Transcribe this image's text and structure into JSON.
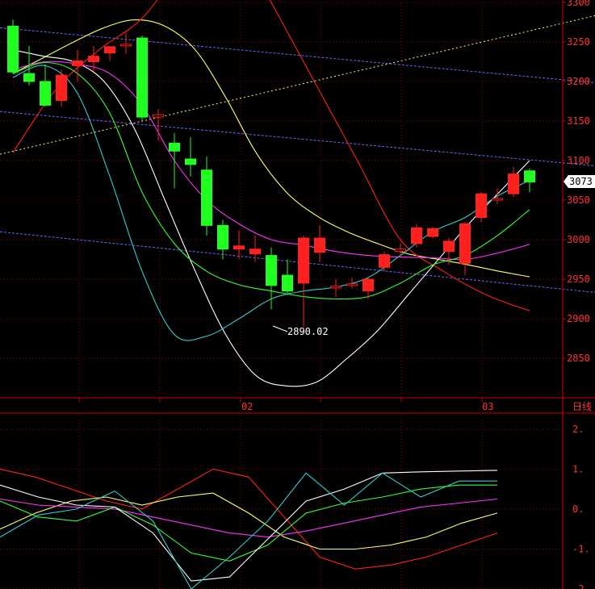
{
  "chart_data": {
    "type": "candlestick",
    "price_panel": {
      "ylim": [
        2800,
        3300
      ],
      "y_ticks": [
        "3300",
        "3250",
        "3200",
        "3150",
        "3100",
        "3050",
        "3000",
        "2950",
        "2900",
        "2850"
      ],
      "x_ticks": [
        "02",
        "03"
      ],
      "period_label": "日线",
      "current_price": "3073",
      "low_annotation": "2890.02",
      "colors": {
        "up": "#ff2020",
        "down": "#20ff20",
        "grid": "#8b0000"
      },
      "candles": [
        {
          "o": 3270,
          "h": 3278,
          "l": 3210,
          "c": 3212
        },
        {
          "o": 3210,
          "h": 3245,
          "l": 3195,
          "c": 3200
        },
        {
          "o": 3200,
          "h": 3222,
          "l": 3168,
          "c": 3170
        },
        {
          "o": 3176,
          "h": 3215,
          "l": 3168,
          "c": 3208
        },
        {
          "o": 3220,
          "h": 3240,
          "l": 3200,
          "c": 3226
        },
        {
          "o": 3225,
          "h": 3245,
          "l": 3212,
          "c": 3232
        },
        {
          "o": 3236,
          "h": 3245,
          "l": 3226,
          "c": 3244
        },
        {
          "o": 3245,
          "h": 3262,
          "l": 3235,
          "c": 3247
        },
        {
          "o": 3255,
          "h": 3258,
          "l": 3150,
          "c": 3155
        },
        {
          "o": 3155,
          "h": 3165,
          "l": 3125,
          "c": 3158
        },
        {
          "o": 3122,
          "h": 3135,
          "l": 3065,
          "c": 3112
        },
        {
          "o": 3102,
          "h": 3130,
          "l": 3080,
          "c": 3095
        },
        {
          "o": 3088,
          "h": 3105,
          "l": 3005,
          "c": 3018
        },
        {
          "o": 3018,
          "h": 3025,
          "l": 2975,
          "c": 2988
        },
        {
          "o": 2988,
          "h": 3012,
          "l": 2975,
          "c": 2992
        },
        {
          "o": 2982,
          "h": 3005,
          "l": 2972,
          "c": 2988
        },
        {
          "o": 2980,
          "h": 2990,
          "l": 2912,
          "c": 2942
        },
        {
          "o": 2955,
          "h": 2975,
          "l": 2930,
          "c": 2935
        },
        {
          "o": 2945,
          "h": 3005,
          "l": 2890,
          "c": 3002
        },
        {
          "o": 2984,
          "h": 3018,
          "l": 2972,
          "c": 3002
        },
        {
          "o": 2939,
          "h": 2950,
          "l": 2928,
          "c": 2941
        },
        {
          "o": 2942,
          "h": 2952,
          "l": 2938,
          "c": 2944
        },
        {
          "o": 2935,
          "h": 2952,
          "l": 2925,
          "c": 2950
        },
        {
          "o": 2965,
          "h": 2985,
          "l": 2960,
          "c": 2981
        },
        {
          "o": 2985,
          "h": 2995,
          "l": 2978,
          "c": 2988
        },
        {
          "o": 2995,
          "h": 3020,
          "l": 2990,
          "c": 3015
        },
        {
          "o": 3004,
          "h": 3016,
          "l": 3002,
          "c": 3014
        },
        {
          "o": 2985,
          "h": 3002,
          "l": 2968,
          "c": 2998
        },
        {
          "o": 2970,
          "h": 3022,
          "l": 2955,
          "c": 3020
        },
        {
          "o": 3028,
          "h": 3060,
          "l": 3022,
          "c": 3058
        },
        {
          "o": 3050,
          "h": 3065,
          "l": 3045,
          "c": 3052
        },
        {
          "o": 3058,
          "h": 3092,
          "l": 3054,
          "c": 3083
        },
        {
          "o": 3087,
          "h": 3090,
          "l": 3060,
          "c": 3073
        }
      ],
      "ma_lines": [
        {
          "color": "#ffff66",
          "values": [
            3210,
            3230,
            3250,
            3268,
            3278,
            3270,
            3240,
            3180,
            3110,
            3060,
            3030,
            3010,
            2995,
            2982,
            2975,
            2968,
            2960,
            2953
          ]
        },
        {
          "color": "#ff2020",
          "values": [
            3110,
            3190,
            3240,
            3280,
            3350,
            3400,
            3300,
            3200,
            3100,
            3000,
            2960,
            2930,
            2910
          ]
        },
        {
          "color": "#ffffff",
          "values": [
            3240,
            3232,
            3225,
            3200,
            3140,
            3050,
            2960,
            2880,
            2828,
            2815,
            2820,
            2850,
            2885,
            2930,
            2975,
            3020,
            3060,
            3100
          ]
        },
        {
          "color": "#ff33ff",
          "values": [
            3215,
            3225,
            3222,
            3210,
            3170,
            3100,
            3050,
            3020,
            3000,
            2993,
            2985,
            2980,
            2978,
            2977,
            2975,
            2983,
            2994
          ]
        },
        {
          "color": "#33ff33",
          "values": [
            3210,
            3224,
            3210,
            3160,
            3060,
            2995,
            2960,
            2943,
            2935,
            2928,
            2925,
            2928,
            2945,
            2968,
            2980,
            3005,
            3038
          ]
        },
        {
          "color": "#33cccc",
          "values": [
            3205,
            3220,
            3185,
            3080,
            2960,
            2880,
            2878,
            2900,
            2925,
            2935,
            2940,
            2952,
            2980,
            3010,
            3028,
            3055,
            3075
          ]
        }
      ],
      "trend_lines": [
        {
          "color": "#ffff66",
          "style": "dotted",
          "from": [
            0,
            3108
          ],
          "to": [
            40,
            3302
          ]
        },
        {
          "color": "#6666ff",
          "style": "dashed",
          "from": [
            0,
            3268
          ],
          "to": [
            40,
            3191
          ]
        },
        {
          "color": "#6666ff",
          "style": "dashed",
          "from": [
            0,
            3162
          ],
          "to": [
            40,
            3086
          ]
        },
        {
          "color": "#6666ff",
          "style": "dashed",
          "from": [
            0,
            3010
          ],
          "to": [
            40,
            2925
          ]
        }
      ]
    },
    "indicator_panel": {
      "ylim": [
        -2,
        2.4
      ],
      "y_ticks": [
        "2.",
        "1.",
        "0.",
        "-1.",
        "-2"
      ],
      "lines": [
        {
          "color": "#ff2020",
          "values": [
            1.0,
            0.8,
            0.5,
            0.2,
            0.0,
            0.5,
            1.0,
            0.8,
            -0.2,
            -1.2,
            -1.5,
            -1.4,
            -1.2,
            -0.9,
            -0.6
          ]
        },
        {
          "color": "#ffff66",
          "values": [
            -0.5,
            -0.1,
            0.2,
            0.3,
            0.1,
            0.3,
            0.4,
            -0.1,
            -0.7,
            -1.0,
            -1.0,
            -0.9,
            -0.7,
            -0.35,
            -0.1
          ]
        },
        {
          "color": "#ff33ff",
          "values": [
            0.25,
            0.1,
            0.05,
            0.0,
            -0.2,
            -0.4,
            -0.6,
            -0.7,
            -0.55,
            -0.35,
            -0.15,
            0.05,
            0.15,
            0.25
          ]
        },
        {
          "color": "#33ff33",
          "values": [
            0.2,
            -0.2,
            -0.3,
            0.05,
            -0.4,
            -1.1,
            -1.3,
            -0.9,
            -0.1,
            0.15,
            0.3,
            0.5,
            0.6,
            0.6
          ]
        },
        {
          "color": "#ffffff",
          "values": [
            0.6,
            0.3,
            0.1,
            0.05,
            -0.6,
            -1.8,
            -1.7,
            -0.75,
            0.2,
            0.5,
            0.9,
            0.93,
            0.95,
            0.97
          ]
        },
        {
          "color": "#33cccc",
          "values": [
            -0.7,
            -0.15,
            0.0,
            0.45,
            -0.3,
            -2.0,
            -1.2,
            -0.3,
            0.9,
            0.1,
            0.9,
            0.3,
            0.7,
            0.7
          ]
        }
      ]
    }
  }
}
